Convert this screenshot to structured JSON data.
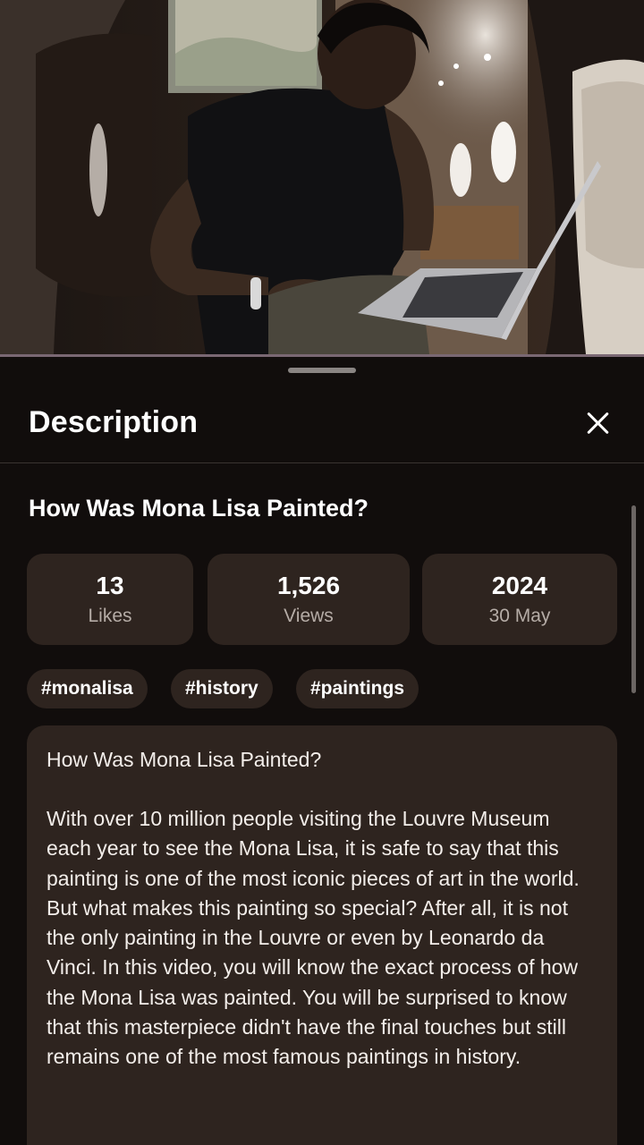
{
  "sheet": {
    "title": "Description"
  },
  "video": {
    "title": "How Was Mona Lisa Painted?"
  },
  "stats": [
    {
      "value": "13",
      "label": "Likes"
    },
    {
      "value": "1,526",
      "label": "Views"
    },
    {
      "value": "2024",
      "label": "30 May"
    }
  ],
  "tags": [
    "#monalisa",
    "#history",
    "#paintings"
  ],
  "description": {
    "heading": "How Was Mona Lisa Painted?",
    "body": "With over 10 million people visiting the Louvre Museum each year to see the Mona Lisa, it is safe to say that this painting is one of the most iconic pieces of art in the world. But what makes this painting so special? After all, it is not the only painting in the Louvre or even by Leonardo da Vinci. In this video, you will know the exact process of how the Mona Lisa was painted. You will be surprised to know that this masterpiece didn't have the final touches but still remains one of the most famous paintings in history."
  },
  "icons": {
    "close": "close-icon"
  },
  "colors": {
    "sheet_background": "#110d0c",
    "card_background": "#2e241f",
    "secondary_text": "#b5aca6"
  }
}
